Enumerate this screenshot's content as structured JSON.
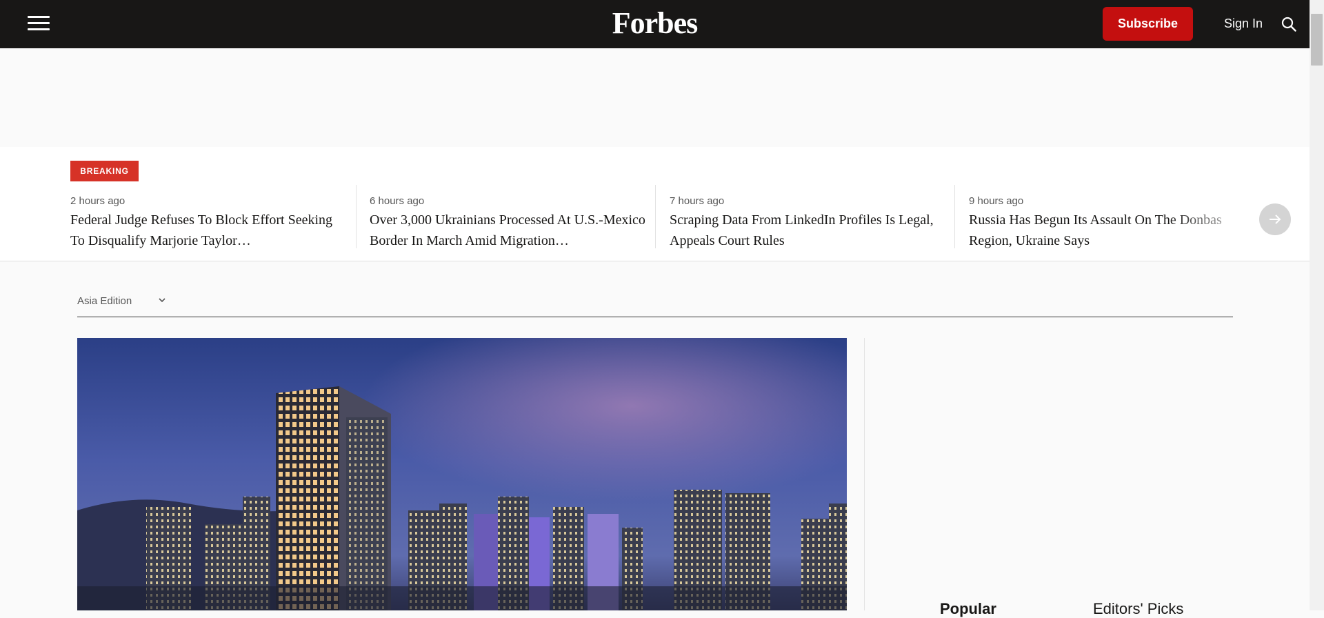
{
  "header": {
    "logo_text": "Forbes",
    "subscribe_label": "Subscribe",
    "signin_label": "Sign In",
    "menu_icon": "hamburger-menu-icon",
    "search_icon": "search-icon",
    "colors": {
      "bar": "#181716",
      "subscribe": "#c40f0f"
    }
  },
  "breaking": {
    "badge": "BREAKING",
    "items": [
      {
        "time": "2 hours ago",
        "headline": "Federal Judge Refuses To Block Effort Seeking To Disqualify Marjorie Taylor…"
      },
      {
        "time": "6 hours ago",
        "headline": "Over 3,000 Ukrainians Processed At U.S.-Mexico Border In March Amid Migration…"
      },
      {
        "time": "7 hours ago",
        "headline": "Scraping Data From LinkedIn Profiles Is Legal, Appeals Court Rules"
      },
      {
        "time": "9 hours ago",
        "headline": "Russia Has Begun Its Assault On The Donbas Region, Ukraine Says"
      }
    ],
    "next_icon": "arrow-right-icon",
    "badge_color": "#d63227"
  },
  "edition": {
    "label": "Asia Edition",
    "chevron_icon": "chevron-down-icon"
  },
  "sidebar": {
    "tabs": [
      "Popular",
      "Editors' Picks"
    ]
  }
}
